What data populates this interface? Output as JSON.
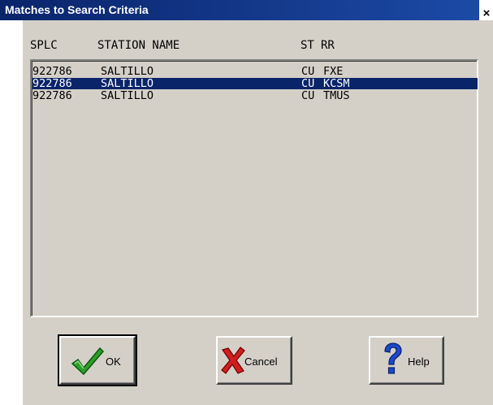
{
  "window": {
    "title": "Matches to Search Criteria",
    "close_glyph": "×"
  },
  "columns": {
    "splc": "SPLC",
    "station": "STATION NAME",
    "st": "ST",
    "rr": "RR"
  },
  "rows": [
    {
      "splc": "922786",
      "station": "SALTILLO",
      "st": "CU",
      "rr": "FXE",
      "selected": false
    },
    {
      "splc": "922786",
      "station": "SALTILLO",
      "st": "CU",
      "rr": "KCSM",
      "selected": true
    },
    {
      "splc": "922786",
      "station": "SALTILLO",
      "st": "CU",
      "rr": "TMUS",
      "selected": false
    }
  ],
  "buttons": {
    "ok": "OK",
    "cancel": "Cancel",
    "help": "Help"
  },
  "icons": {
    "ok": "green-checkmark-icon",
    "cancel": "red-x-icon",
    "help": "blue-question-mark-icon"
  },
  "colors": {
    "title_bar": "#0a246a",
    "selection": "#0a246a",
    "face": "#d4d0c8"
  }
}
